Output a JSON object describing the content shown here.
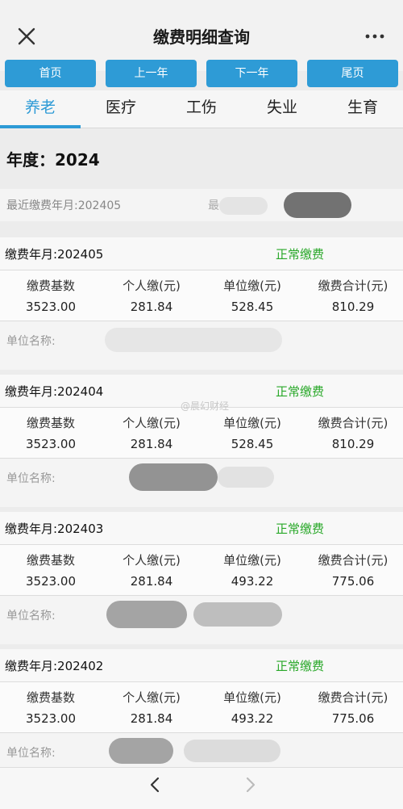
{
  "header": {
    "title": "缴费明细查询"
  },
  "nav_buttons": [
    "首页",
    "上一年",
    "下一年",
    "尾页"
  ],
  "tabs": [
    "养老",
    "医疗",
    "工伤",
    "失业",
    "生育"
  ],
  "active_tab_index": 0,
  "year_label": "年度：2024",
  "recent": {
    "label": "最近缴费年月:202405",
    "label2": "最"
  },
  "columns": [
    "缴费基数",
    "个人缴(元)",
    "单位缴(元)",
    "缴费合计(元)"
  ],
  "records": [
    {
      "ym": "缴费年月:202405",
      "status": "正常缴费",
      "values": [
        "3523.00",
        "281.84",
        "528.45",
        "810.29"
      ],
      "unit_label": "单位名称:"
    },
    {
      "ym": "缴费年月:202404",
      "status": "正常缴费",
      "values": [
        "3523.00",
        "281.84",
        "528.45",
        "810.29"
      ],
      "unit_label": "单位名称:"
    },
    {
      "ym": "缴费年月:202403",
      "status": "正常缴费",
      "values": [
        "3523.00",
        "281.84",
        "493.22",
        "775.06"
      ],
      "unit_label": "单位名称:"
    },
    {
      "ym": "缴费年月:202402",
      "status": "正常缴费",
      "values": [
        "3523.00",
        "281.84",
        "493.22",
        "775.06"
      ],
      "unit_label": "单位名称:"
    }
  ],
  "watermark": "@晨幻财经",
  "icons": {
    "close": "close-icon",
    "more": "more-icon",
    "back": "chevron-left-icon",
    "forward": "chevron-right-icon"
  },
  "colors": {
    "accent": "#2e9bd6",
    "status": "#29a829"
  }
}
